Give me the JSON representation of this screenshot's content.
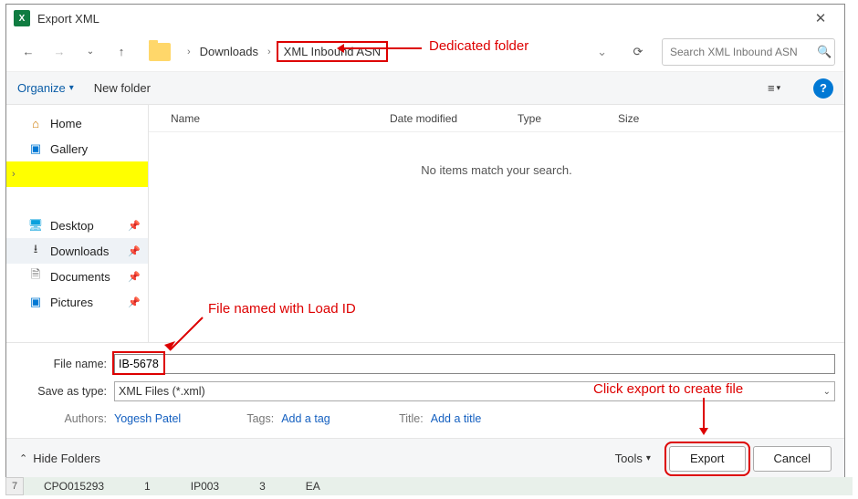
{
  "titlebar": {
    "app_icon_letter": "X",
    "title": "Export XML"
  },
  "nav": {
    "crumb_downloads": "Downloads",
    "crumb_target": "XML Inbound ASN"
  },
  "search": {
    "placeholder": "Search XML Inbound ASN"
  },
  "cmdbar": {
    "organize": "Organize",
    "newfolder": "New folder"
  },
  "sidebar": {
    "home": "Home",
    "gallery": "Gallery",
    "desktop": "Desktop",
    "downloads": "Downloads",
    "documents": "Documents",
    "pictures": "Pictures"
  },
  "cols": {
    "name": "Name",
    "date": "Date modified",
    "type": "Type",
    "size": "Size"
  },
  "empty_message": "No items match your search.",
  "form": {
    "filename_label": "File name:",
    "filename_value": "IB-5678",
    "saveas_label": "Save as type:",
    "saveas_value": "XML Files (*.xml)",
    "authors_label": "Authors:",
    "authors_value": "Yogesh Patel",
    "tags_label": "Tags:",
    "tags_value": "Add a tag",
    "title_label": "Title:",
    "title_value": "Add a title"
  },
  "footer": {
    "hide_folders": "Hide Folders",
    "tools": "Tools",
    "export": "Export",
    "cancel": "Cancel"
  },
  "bg": {
    "rownum": "7",
    "c1": "CPO015293",
    "c2": "1",
    "c3": "IP003",
    "c4": "3",
    "c5": "EA"
  },
  "annotations": {
    "folder": "Dedicated folder",
    "filename": "File named with Load ID",
    "export": "Click export to create file"
  }
}
